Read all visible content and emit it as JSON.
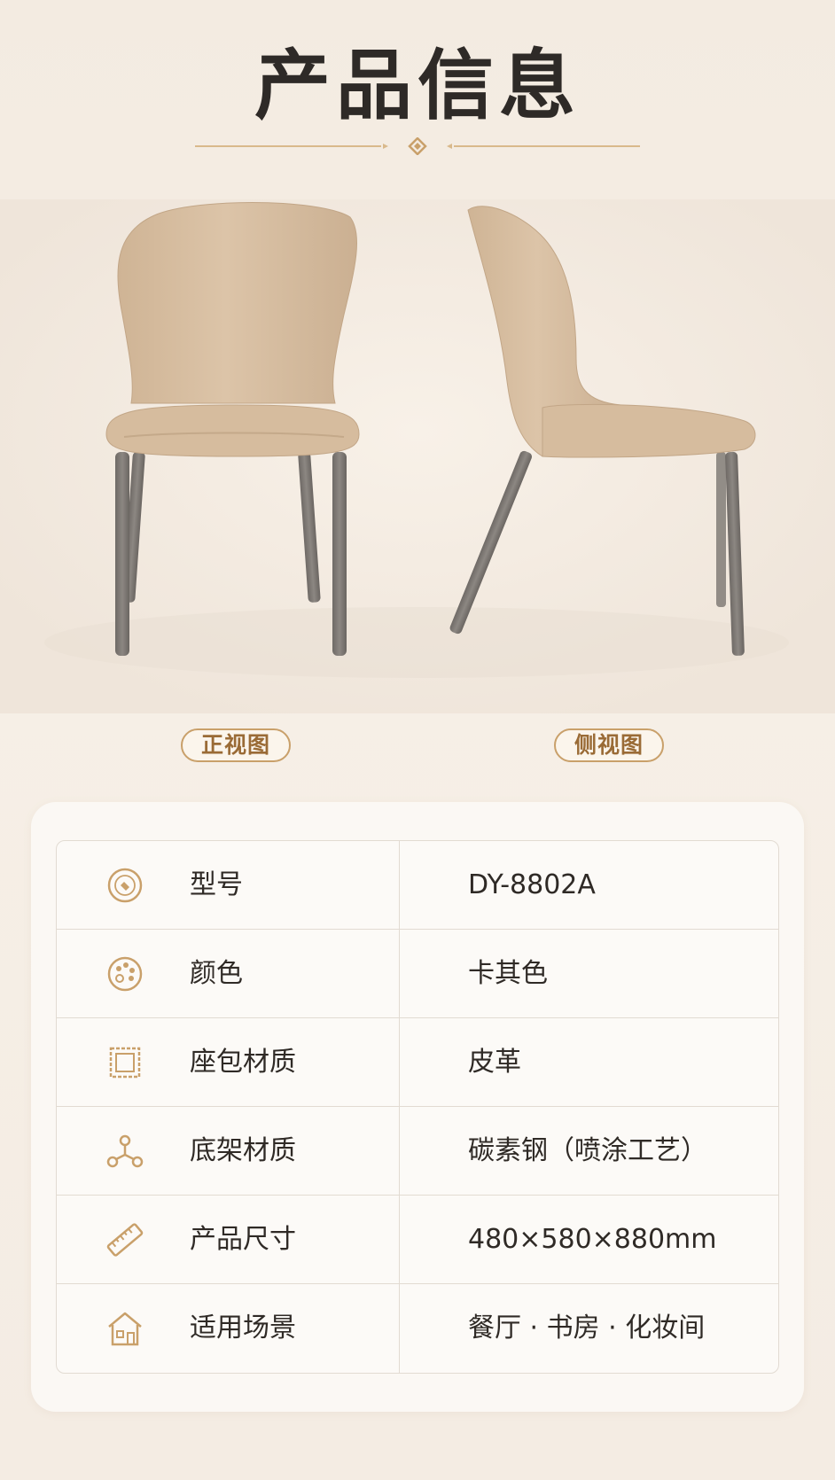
{
  "header": {
    "title": "产品信息"
  },
  "views": {
    "front_label": "正视图",
    "side_label": "侧视图"
  },
  "colors": {
    "accent": "#c9a06a",
    "label_text": "#9a6b36",
    "chair_leather": "#d8bfa3",
    "chair_legs": "#7a7571"
  },
  "specs": [
    {
      "icon": "model-badge-icon",
      "label": "型号",
      "value": "DY-8802A"
    },
    {
      "icon": "color-palette-icon",
      "label": "颜色",
      "value": "卡其色"
    },
    {
      "icon": "fabric-swatch-icon",
      "label": "座包材质",
      "value": "皮革"
    },
    {
      "icon": "frame-structure-icon",
      "label": "底架材质",
      "value": "碳素钢（喷涂工艺）"
    },
    {
      "icon": "ruler-icon",
      "label": "产品尺寸",
      "value": "480×580×880mm"
    },
    {
      "icon": "house-icon",
      "label": "适用场景",
      "value": "餐厅 · 书房 · 化妆间"
    }
  ]
}
